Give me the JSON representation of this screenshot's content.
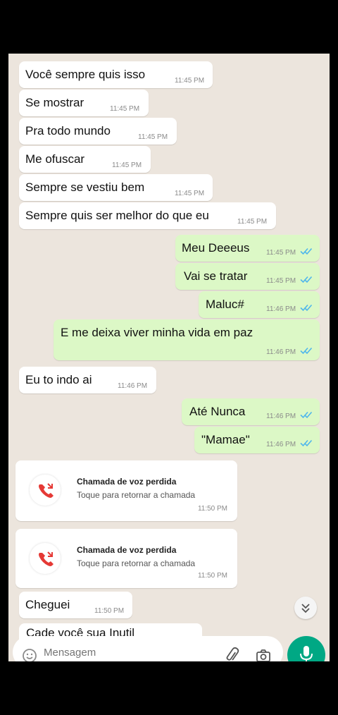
{
  "messages": [
    {
      "dir": "in",
      "text": "Você sempre quis isso",
      "time": "11:45 PM"
    },
    {
      "dir": "in",
      "text": "Se mostrar",
      "time": "11:45 PM"
    },
    {
      "dir": "in",
      "text": "Pra todo mundo",
      "time": "11:45 PM"
    },
    {
      "dir": "in",
      "text": "Me ofuscar",
      "time": "11:45 PM"
    },
    {
      "dir": "in",
      "text": "Sempre se vestiu bem",
      "time": "11:45 PM"
    },
    {
      "dir": "in",
      "text": "Sempre quis ser melhor do que eu",
      "time": "11:45 PM"
    },
    {
      "dir": "out",
      "text": "Meu Deeeus",
      "time": "11:45 PM"
    },
    {
      "dir": "out",
      "text": "Vai se tratar",
      "time": "11:45 PM"
    },
    {
      "dir": "out",
      "text": "Maluc#",
      "time": "11:46 PM"
    },
    {
      "dir": "out",
      "text": "E me deixa viver minha vida em paz",
      "time": "11:46 PM"
    },
    {
      "dir": "in",
      "text": "Eu to indo ai",
      "time": "11:46 PM"
    },
    {
      "dir": "out",
      "text": "Até Nunca",
      "time": "11:46 PM"
    },
    {
      "dir": "out",
      "text": "\"Mamae\"",
      "time": "11:46 PM"
    }
  ],
  "calls": [
    {
      "title": "Chamada de voz perdida",
      "subtitle": "Toque para retornar a chamada",
      "time": "11:50 PM"
    },
    {
      "title": "Chamada de voz perdida",
      "subtitle": "Toque para retornar a chamada",
      "time": "11:50 PM"
    }
  ],
  "last_message": {
    "text": "Cheguei",
    "time": "11:50 PM"
  },
  "partial_message": {
    "text": "Cade você sua Inutil"
  },
  "input": {
    "placeholder": "Mensagem"
  },
  "colors": {
    "incoming": "#ffffff",
    "outgoing": "#dcf8c6",
    "read_tick": "#4fb6ec",
    "mic": "#00a884",
    "missed_call": "#e53935",
    "chat_bg": "#ece5dd"
  },
  "icons": {
    "read": "double-check-icon",
    "call": "missed-call-icon",
    "scroll": "chevron-down-icon",
    "emoji": "emoji-icon",
    "attach": "paperclip-icon",
    "camera": "camera-icon",
    "mic": "mic-icon"
  }
}
